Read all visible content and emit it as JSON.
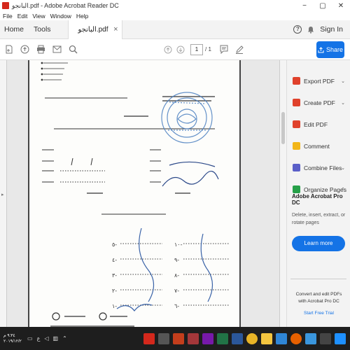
{
  "window": {
    "title": "البانجو.pdf - Adobe Acrobat Reader DC",
    "controls": [
      "−",
      "▢",
      "✕"
    ]
  },
  "menu": [
    "File",
    "Edit",
    "View",
    "Window",
    "Help"
  ],
  "tabs": {
    "home": "Home",
    "tools": "Tools",
    "document": "البانجو.pdf",
    "close": "×"
  },
  "header_right": {
    "help": "?",
    "signin": "Sign In"
  },
  "toolbar": {
    "page_current": "1",
    "page_total": "/ 1",
    "share_label": "Share"
  },
  "tools_panel": {
    "items": [
      {
        "label": "Export PDF",
        "color": "#e0412b",
        "chevron": "⌄"
      },
      {
        "label": "Create PDF",
        "color": "#e0412b",
        "chevron": "⌄"
      },
      {
        "label": "Edit PDF",
        "color": "#e0412b",
        "chevron": ""
      },
      {
        "label": "Comment",
        "color": "#f2b619",
        "chevron": ""
      },
      {
        "label": "Combine Files",
        "color": "#5a5fc8",
        "chevron": "⌄"
      },
      {
        "label": "Organize Pages",
        "color": "#27a049",
        "chevron": "⌃"
      }
    ],
    "pro_title": "Adobe Acrobat Pro DC",
    "pro_desc": "Delete, insert, extract, or rotate pages",
    "learn_more": "Learn more",
    "promo_line1": "Convert and edit PDFs",
    "promo_line2": "with Acrobat Pro DC",
    "free_trial": "Start Free Trial"
  },
  "taskbar": {
    "time": "٩:٣٤ م",
    "date": "٢٠١٩/١٢/٢",
    "tray_text": "ع"
  }
}
